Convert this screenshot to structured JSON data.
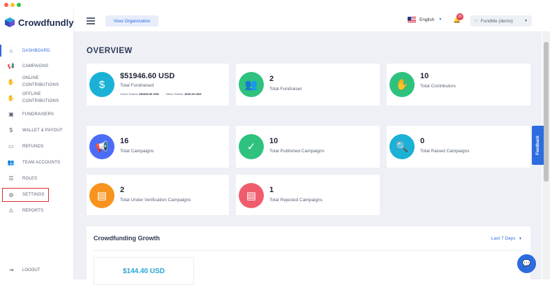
{
  "app": {
    "logo_text": "Crowdfundly"
  },
  "colors": {
    "accent": "#2d6cdf",
    "dot_red": "#ff5f57",
    "dot_yellow": "#ffbd2e",
    "dot_green": "#28c840",
    "teal": "#1bb1d6",
    "green": "#2ec27e",
    "indigo": "#4a6cf7",
    "orange": "#f7931e",
    "coral": "#ef5d6c"
  },
  "sidebar": {
    "items": [
      {
        "label": "DASHBOARD",
        "icon": "home-icon"
      },
      {
        "label": "CAMPAIGNS",
        "icon": "megaphone-icon"
      },
      {
        "label": "ONLINE CONTRIBUTIONS",
        "icon": "hand-coin-icon"
      },
      {
        "label": "OFFLINE CONTRIBUTIONS",
        "icon": "hand-coin-icon"
      },
      {
        "label": "FUNDRAISERS",
        "icon": "id-card-icon"
      },
      {
        "label": "WALLET & PAYOUT",
        "icon": "dollar-icon"
      },
      {
        "label": "REFUNDS",
        "icon": "refund-icon"
      },
      {
        "label": "TEAM ACCOUNTS",
        "icon": "team-icon"
      },
      {
        "label": "ROLES",
        "icon": "list-icon"
      },
      {
        "label": "SETTINGS",
        "icon": "gears-icon"
      },
      {
        "label": "REPORTS",
        "icon": "warning-icon"
      }
    ],
    "logout": "LOGOUT"
  },
  "topbar": {
    "view_org": "View Organization",
    "language": "English",
    "notif_count": "29",
    "user": "FundMe (demo)"
  },
  "overview": {
    "title": "OVERVIEW",
    "stats": [
      {
        "value": "$51946.60 USD",
        "label": "Total Fundraised",
        "sub_online_label": "Online Raised:",
        "sub_online": "$51946.60 USD",
        "sub_offline_label": "Offline Raised:",
        "sub_offline": "$100.00 USD"
      },
      {
        "value": "2",
        "label": "Total Fundraiser"
      },
      {
        "value": "10",
        "label": "Total Contributors"
      },
      {
        "value": "16",
        "label": "Total Campaigns"
      },
      {
        "value": "10",
        "label": "Total Published Campaigns"
      },
      {
        "value": "0",
        "label": "Total Raised Campaigns"
      },
      {
        "value": "2",
        "label": "Total Under Verification Campaigns"
      },
      {
        "value": "1",
        "label": "Total Rejected Campaigns"
      }
    ]
  },
  "growth": {
    "title": "Crowdfunding Growth",
    "range": "Last 7 Days",
    "amount": "$144.40 USD"
  },
  "feedback": "Feedback"
}
